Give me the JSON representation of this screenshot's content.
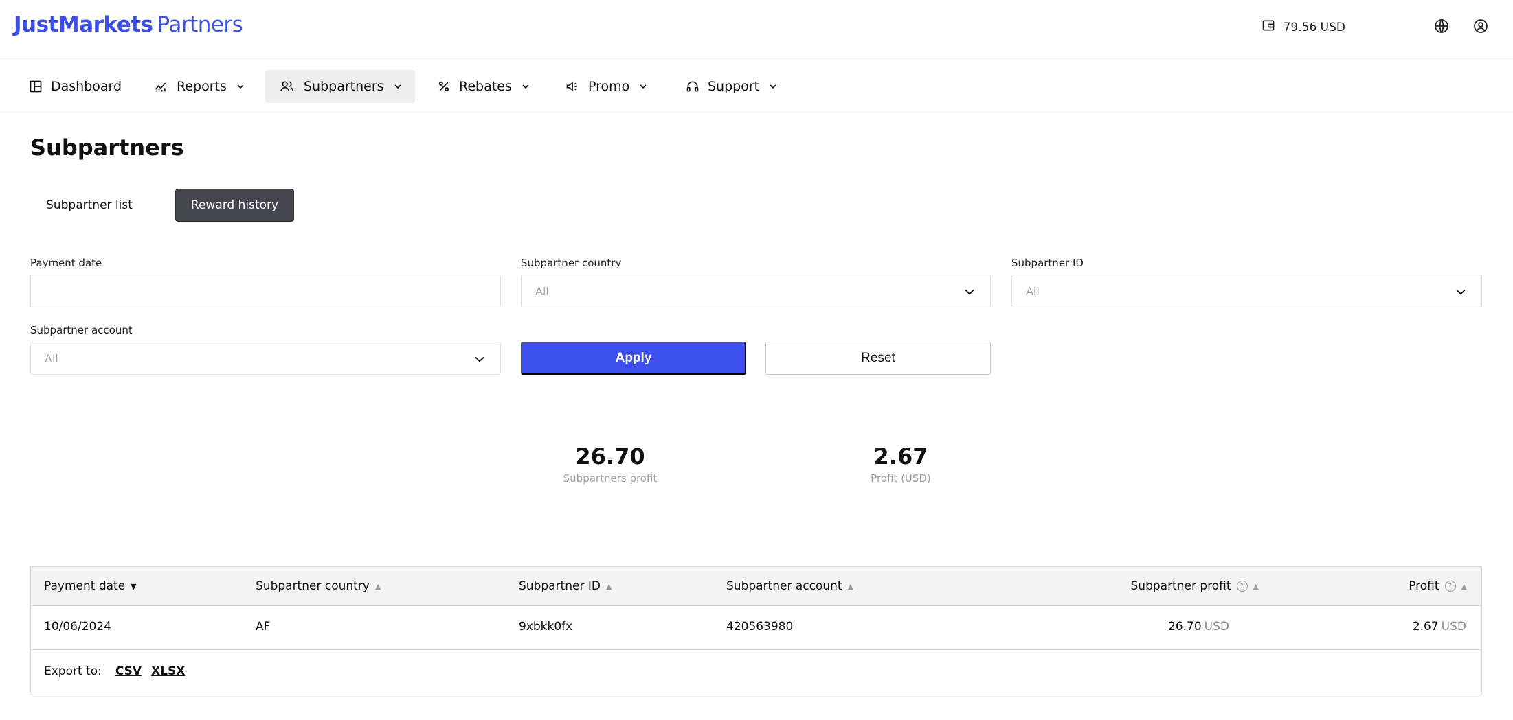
{
  "header": {
    "logo_brand": "JustMarkets",
    "logo_suffix": "Partners",
    "balance": "79.56 USD",
    "icons": [
      "wallet-icon",
      "globe-icon",
      "user-account-icon"
    ]
  },
  "nav": {
    "items": [
      {
        "label": "Dashboard",
        "icon": "dashboard-icon",
        "dropdown": false
      },
      {
        "label": "Reports",
        "icon": "chart-icon",
        "dropdown": true
      },
      {
        "label": "Subpartners",
        "icon": "users-icon",
        "dropdown": true,
        "active": true
      },
      {
        "label": "Rebates",
        "icon": "percent-icon",
        "dropdown": true
      },
      {
        "label": "Promo",
        "icon": "megaphone-icon",
        "dropdown": true
      },
      {
        "label": "Support",
        "icon": "headset-icon",
        "dropdown": true
      }
    ]
  },
  "page": {
    "title": "Subpartners",
    "tabs": [
      {
        "label": "Subpartner list",
        "active": false
      },
      {
        "label": "Reward history",
        "active": true
      }
    ]
  },
  "filters": {
    "payment_date": {
      "label": "Payment date",
      "value": ""
    },
    "subpartner_country": {
      "label": "Subpartner country",
      "value": "All"
    },
    "subpartner_id": {
      "label": "Subpartner ID",
      "value": "All"
    },
    "subpartner_account": {
      "label": "Subpartner account",
      "value": "All"
    },
    "apply_label": "Apply",
    "reset_label": "Reset"
  },
  "summary": {
    "subpartners_profit": {
      "value": "26.70",
      "label": "Subpartners profit"
    },
    "profit": {
      "value": "2.67",
      "label": "Profit (USD)"
    }
  },
  "table": {
    "columns": [
      "Payment date",
      "Subpartner country",
      "Subpartner ID",
      "Subpartner account",
      "Subpartner profit",
      "Profit"
    ],
    "sort": {
      "column": "Payment date",
      "direction": "desc"
    },
    "rows": [
      {
        "payment_date": "10/06/2024",
        "country": "AF",
        "subpartner_id": "9xbkk0fx",
        "account": "420563980",
        "subpartner_profit": "26.70",
        "subpartner_profit_unit": "USD",
        "profit": "2.67",
        "profit_unit": "USD"
      }
    ],
    "export": {
      "label": "Export to:",
      "formats": [
        "CSV",
        "XLSX"
      ]
    }
  },
  "colors": {
    "brand": "#3e4fe6",
    "apply_button": "#3e4ff0",
    "active_tab": "#45454d"
  }
}
